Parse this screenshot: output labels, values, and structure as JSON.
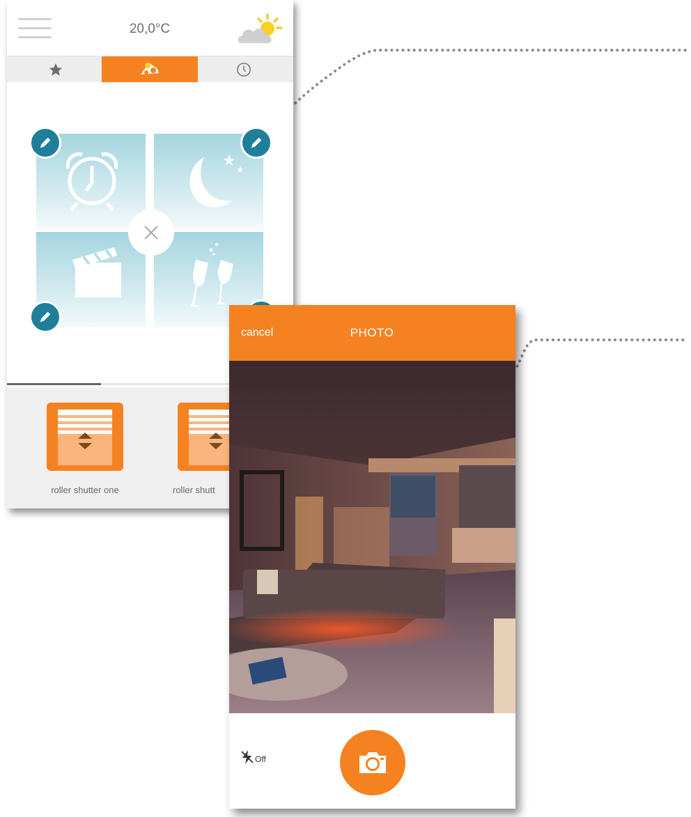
{
  "scenes_screen": {
    "temperature": "20,0°C",
    "weather_icon": "sun-behind-cloud-icon",
    "tabs": [
      {
        "icon": "star-icon"
      },
      {
        "icon": "scenes-icon",
        "active": true
      },
      {
        "icon": "clock-icon"
      }
    ],
    "scene_tiles": [
      {
        "icon": "alarm-clock-icon"
      },
      {
        "icon": "moon-and-stars-icon"
      },
      {
        "icon": "clapperboard-icon"
      },
      {
        "icon": "champagne-glasses-icon"
      }
    ],
    "shutters": [
      {
        "label": "roller shutter one"
      },
      {
        "label": "roller shutt"
      }
    ],
    "colors": {
      "accent": "#f58220",
      "edit": "#1f7f9b"
    }
  },
  "photo_screen": {
    "cancel_label": "cancel",
    "title": "PHOTO",
    "flash_label": "Off",
    "flash_icon": "flash-off-icon",
    "capture_icon": "camera-icon"
  }
}
